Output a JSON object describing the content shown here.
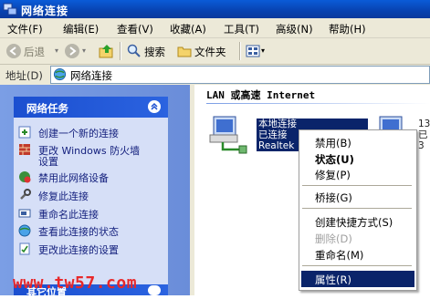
{
  "window": {
    "title": "网络连接"
  },
  "menubar": [
    {
      "label": "文件(F)"
    },
    {
      "label": "编辑(E)"
    },
    {
      "label": "查看(V)"
    },
    {
      "label": "收藏(A)"
    },
    {
      "label": "工具(T)"
    },
    {
      "label": "高级(N)"
    },
    {
      "label": "帮助(H)"
    }
  ],
  "toolbar": {
    "back": "后退",
    "search": "搜索",
    "folders": "文件夹"
  },
  "address": {
    "label": "地址(D)",
    "value": "网络连接"
  },
  "tasks": {
    "heading": "网络任务",
    "items": [
      {
        "label": "创建一个新的连接"
      },
      {
        "label": "更改 Windows 防火墙"
      },
      {
        "label": "设置"
      },
      {
        "label": "禁用此网络设备"
      },
      {
        "label": "修复此连接"
      },
      {
        "label": "重命名此连接"
      },
      {
        "label": "查看此连接的状态"
      },
      {
        "label": "更改此连接的设置"
      }
    ],
    "other_heading": "其它位置"
  },
  "watermark": "www.tw57.com",
  "group": {
    "heading": "LAN 或高速 Internet"
  },
  "connection": {
    "name": "本地连接",
    "status": "已连接",
    "device": "Realtek"
  },
  "connection2": {
    "line1": "13",
    "line2": "已",
    "line3": "3"
  },
  "context_menu": {
    "items": [
      {
        "label": "禁用(B)"
      },
      {
        "label": "状态(U)"
      },
      {
        "label": "修复(P)"
      },
      {
        "label": "桥接(G)"
      },
      {
        "label": "创建快捷方式(S)"
      },
      {
        "label": "删除(D)"
      },
      {
        "label": "重命名(M)"
      },
      {
        "label": "属性(R)"
      }
    ]
  },
  "colors": {
    "titlebar": "#0842b0",
    "selection": "#0a246a",
    "task_text": "#15217e",
    "watermark": "#e8282a"
  }
}
